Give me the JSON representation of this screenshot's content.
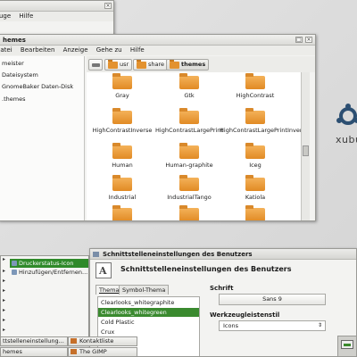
{
  "back_window": {
    "menu": [
      "uge",
      "Hilfe"
    ]
  },
  "file_manager": {
    "title": "hemes",
    "menu": [
      "Datei",
      "Bearbeiten",
      "Anzeige",
      "Gehe zu",
      "Hilfe"
    ],
    "sidebar": [
      {
        "label": "meister",
        "icon": "home-icon"
      },
      {
        "label": "Dateisystem",
        "icon": "drive-icon"
      },
      {
        "label": "GnomeBaker Daten-Disk",
        "icon": "disc-icon"
      },
      {
        "label": ".themes",
        "icon": "folder-icon"
      }
    ],
    "path": [
      "usr",
      "share",
      "themes"
    ],
    "items": [
      "Gray",
      "Gtk",
      "HighContrast",
      "HighContrastInverse",
      "HighContrastLargePrint",
      "HighContrastLargePrintInverse",
      "Human",
      "Human-graphite",
      "Iceg",
      "Industrial",
      "IndustrialTango",
      "Katiola"
    ]
  },
  "brand": {
    "text": "xubu",
    "logo_icon": "xubuntu-logo-icon"
  },
  "menu": {
    "items": [
      {
        "label": "Druckerstatus-Icon",
        "selected": true
      },
      {
        "label": "Hinzufügen/Entfernen...",
        "selected": false
      }
    ]
  },
  "dialog": {
    "title": "Schnittstelleneinstellungen des Benutzers",
    "heading": "Schnittstelleneinstellungen des Benutzers",
    "tabs": [
      "Thema",
      "Symbol-Thema"
    ],
    "themes": [
      {
        "label": "Clearlooks_whitegraphite",
        "selected": false
      },
      {
        "label": "Clearlooks_whitegreen",
        "selected": true
      },
      {
        "label": "Cold Plastic",
        "selected": false
      },
      {
        "label": "Crux",
        "selected": false
      }
    ],
    "font_label": "Schrift",
    "font_value": "Sans 9",
    "toolbar_label": "Werkzeugleistenstil",
    "toolbar_value": "Icons"
  },
  "taskbar": {
    "items": [
      "ttstelleneinstellung...",
      "Kontaktliste",
      "hemes",
      "The GIMP"
    ]
  },
  "colors": {
    "selection_green": "#3a8a2f",
    "folder_orange": "#e18a24"
  }
}
